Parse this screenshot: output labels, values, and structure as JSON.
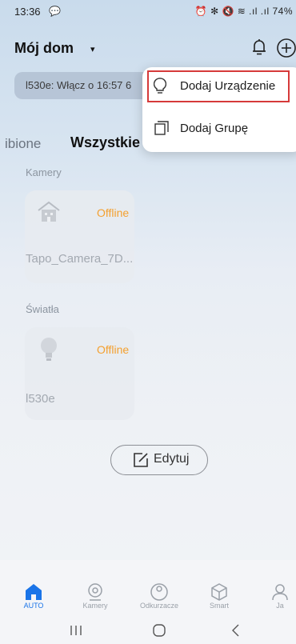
{
  "status_bar": {
    "time": "13:36",
    "right_text": "⏰ ✻ 🔇 ≋ .ıl .ıl 74%"
  },
  "header": {
    "home_title": "Mój dom",
    "caret": "▾"
  },
  "banner": {
    "text": "l530e: Włącz o 16:57 6"
  },
  "tabs": {
    "partial": "ibione",
    "active": "Wszystkie"
  },
  "popup_menu": {
    "items": [
      {
        "label": "Dodaj Urządzenie",
        "icon": "bulb-outline-icon"
      },
      {
        "label": "Dodaj Grupę",
        "icon": "group-icon"
      }
    ]
  },
  "sections": [
    {
      "title": "Kamery",
      "devices": [
        {
          "name": "Tapo_Camera_7D...",
          "status": "Offline",
          "icon": "camera-house-icon"
        }
      ]
    },
    {
      "title": "Światła",
      "devices": [
        {
          "name": "l530e",
          "status": "Offline",
          "icon": "bulb-icon"
        }
      ]
    }
  ],
  "edit_button": {
    "label": "Edytuj"
  },
  "bottom_nav": {
    "items": [
      {
        "label": "AUTO",
        "active": true
      },
      {
        "label": "Kamery",
        "active": false
      },
      {
        "label": "Odkurzacze",
        "active": false
      },
      {
        "label": "Smart",
        "active": false
      },
      {
        "label": "Ja",
        "active": false
      }
    ]
  },
  "colors": {
    "accent": "#1a74e8",
    "offline": "#f4a02f",
    "highlight_border": "#d63a3a"
  }
}
